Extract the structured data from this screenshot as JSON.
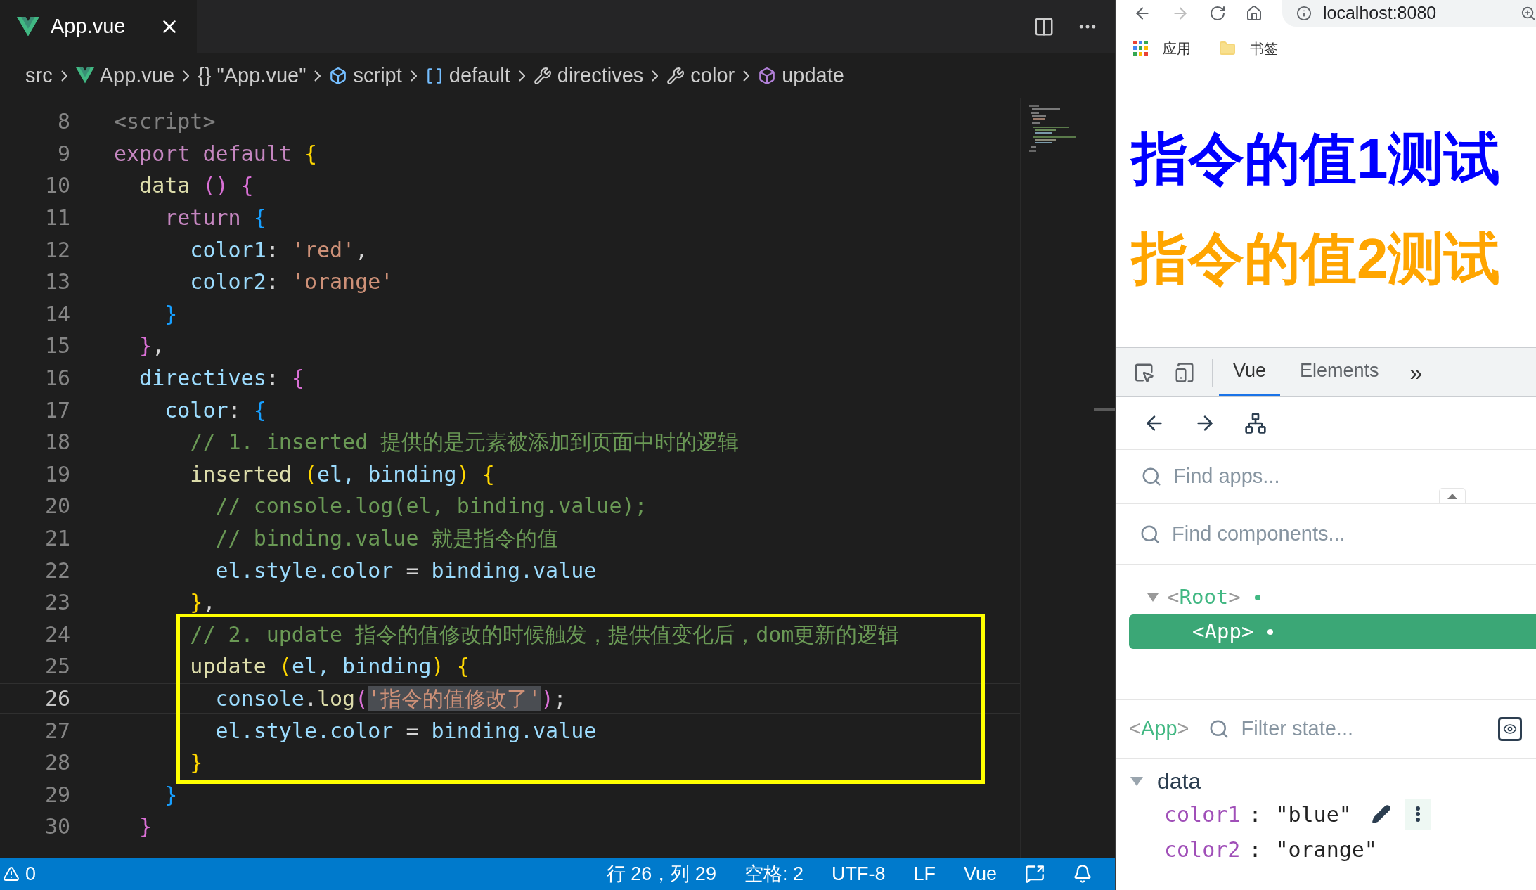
{
  "editor": {
    "tab": {
      "label": "App.vue",
      "selected": true
    },
    "breadcrumbs": [
      {
        "kind": "plain",
        "label": "src"
      },
      {
        "kind": "vue",
        "label": "App.vue"
      },
      {
        "kind": "braces",
        "glyph": "{}",
        "label": "\"App.vue\""
      },
      {
        "kind": "module",
        "label": "script"
      },
      {
        "kind": "variable",
        "label": "default"
      },
      {
        "kind": "wrench",
        "label": "directives"
      },
      {
        "kind": "wrench",
        "label": "color"
      },
      {
        "kind": "method",
        "label": "update"
      }
    ],
    "lines": [
      {
        "number": "8",
        "current": false,
        "boxed": false,
        "tokens": [
          {
            "text": "<script>",
            "kind": "tag"
          }
        ]
      },
      {
        "number": "9",
        "current": false,
        "boxed": false,
        "tokens": [
          {
            "text": "export default ",
            "kind": "keyword"
          },
          {
            "text": "{",
            "kind": "bracket1"
          }
        ]
      },
      {
        "number": "10",
        "current": false,
        "boxed": false,
        "tokens": [
          {
            "text": "  data ",
            "kind": "func"
          },
          {
            "text": "() {",
            "kind": "bracket2"
          }
        ]
      },
      {
        "number": "11",
        "current": false,
        "boxed": false,
        "tokens": [
          {
            "text": "    return ",
            "kind": "keyword"
          },
          {
            "text": "{",
            "kind": "bracket3"
          }
        ]
      },
      {
        "number": "12",
        "current": false,
        "boxed": false,
        "tokens": [
          {
            "text": "      color1",
            "kind": "prop"
          },
          {
            "text": ": ",
            "kind": "plain"
          },
          {
            "text": "'red'",
            "kind": "string"
          },
          {
            "text": ",",
            "kind": "plain"
          }
        ]
      },
      {
        "number": "13",
        "current": false,
        "boxed": false,
        "tokens": [
          {
            "text": "      color2",
            "kind": "prop"
          },
          {
            "text": ": ",
            "kind": "plain"
          },
          {
            "text": "'orange'",
            "kind": "string"
          }
        ]
      },
      {
        "number": "14",
        "current": false,
        "boxed": false,
        "tokens": [
          {
            "text": "    }",
            "kind": "bracket3"
          }
        ]
      },
      {
        "number": "15",
        "current": false,
        "boxed": false,
        "tokens": [
          {
            "text": "  }",
            "kind": "bracket2"
          },
          {
            "text": ",",
            "kind": "plain"
          }
        ]
      },
      {
        "number": "16",
        "current": false,
        "boxed": false,
        "tokens": [
          {
            "text": "  directives",
            "kind": "prop"
          },
          {
            "text": ": ",
            "kind": "plain"
          },
          {
            "text": "{",
            "kind": "bracket2"
          }
        ]
      },
      {
        "number": "17",
        "current": false,
        "boxed": false,
        "tokens": [
          {
            "text": "    color",
            "kind": "prop"
          },
          {
            "text": ": ",
            "kind": "plain"
          },
          {
            "text": "{",
            "kind": "bracket3"
          }
        ]
      },
      {
        "number": "18",
        "current": false,
        "boxed": false,
        "tokens": [
          {
            "text": "      // 1. inserted 提供的是元素被添加到页面中时的逻辑",
            "kind": "comment"
          }
        ]
      },
      {
        "number": "19",
        "current": false,
        "boxed": false,
        "tokens": [
          {
            "text": "      inserted ",
            "kind": "func"
          },
          {
            "text": "(",
            "kind": "bracket1"
          },
          {
            "text": "el, binding",
            "kind": "prop"
          },
          {
            "text": ") {",
            "kind": "bracket1"
          }
        ]
      },
      {
        "number": "20",
        "current": false,
        "boxed": false,
        "tokens": [
          {
            "text": "        // console.log(el, binding.value);",
            "kind": "comment"
          }
        ]
      },
      {
        "number": "21",
        "current": false,
        "boxed": false,
        "tokens": [
          {
            "text": "        // binding.value 就是指令的值",
            "kind": "comment"
          }
        ]
      },
      {
        "number": "22",
        "current": false,
        "boxed": false,
        "tokens": [
          {
            "text": "        el.style.color",
            "kind": "prop"
          },
          {
            "text": " = ",
            "kind": "plain"
          },
          {
            "text": "binding.value",
            "kind": "prop"
          }
        ]
      },
      {
        "number": "23",
        "current": false,
        "boxed": false,
        "tokens": [
          {
            "text": "      }",
            "kind": "bracket1"
          },
          {
            "text": ",",
            "kind": "plain"
          }
        ]
      },
      {
        "number": "24",
        "current": false,
        "boxed": true,
        "tokens": [
          {
            "text": "      // 2. update 指令的值修改的时候触发，提供值变化后，dom更新的逻辑",
            "kind": "comment"
          }
        ]
      },
      {
        "number": "25",
        "current": false,
        "boxed": true,
        "tokens": [
          {
            "text": "      update ",
            "kind": "func"
          },
          {
            "text": "(",
            "kind": "bracket1"
          },
          {
            "text": "el, binding",
            "kind": "prop"
          },
          {
            "text": ") {",
            "kind": "bracket1"
          }
        ]
      },
      {
        "number": "26",
        "current": true,
        "boxed": true,
        "tokens": [
          {
            "text": "        console",
            "kind": "prop"
          },
          {
            "text": ".",
            "kind": "plain"
          },
          {
            "text": "log",
            "kind": "func"
          },
          {
            "text": "(",
            "kind": "bracket2"
          },
          {
            "text": "'指令的值修改了'",
            "kind": "string_match"
          },
          {
            "text": ")",
            "kind": "bracket2"
          },
          {
            "text": ";",
            "kind": "plain"
          }
        ]
      },
      {
        "number": "27",
        "current": false,
        "boxed": true,
        "tokens": [
          {
            "text": "        el.style.color",
            "kind": "prop"
          },
          {
            "text": " = ",
            "kind": "plain"
          },
          {
            "text": "binding.value",
            "kind": "prop"
          }
        ]
      },
      {
        "number": "28",
        "current": false,
        "boxed": true,
        "tokens": [
          {
            "text": "      }",
            "kind": "bracket1"
          }
        ]
      },
      {
        "number": "29",
        "current": false,
        "boxed": false,
        "tokens": [
          {
            "text": "    }",
            "kind": "bracket3"
          }
        ]
      },
      {
        "number": "30",
        "current": false,
        "boxed": false,
        "tokens": [
          {
            "text": "  }",
            "kind": "bracket2"
          }
        ]
      }
    ]
  },
  "status_bar": {
    "warnings": "0",
    "items": [
      "行 26，列 29",
      "空格: 2",
      "UTF-8",
      "LF",
      "Vue"
    ]
  },
  "browser": {
    "address": "localhost:8080",
    "bookmarks": [
      {
        "kind": "apps",
        "label": "应用"
      },
      {
        "kind": "folder",
        "label": "书签"
      }
    ],
    "page_texts": [
      {
        "text": "指令的值1测试",
        "color": "#0000ff"
      },
      {
        "text": "指令的值2测试",
        "color": "#ffa500"
      }
    ]
  },
  "devtools": {
    "tabs": [
      {
        "label": "Vue",
        "selected": true
      },
      {
        "label": "Elements",
        "selected": false
      }
    ],
    "overflow": "»",
    "find_apps": {
      "placeholder": "Find apps..."
    },
    "find_components": {
      "placeholder": "Find components..."
    },
    "tree": [
      {
        "label": "<Root>",
        "expanded": true,
        "selected": false,
        "children": [
          {
            "label": "<App>",
            "selected": true
          }
        ]
      }
    ],
    "inspector": {
      "component": "<App>",
      "filter": {
        "placeholder": "Filter state..."
      },
      "section": {
        "label": "data",
        "expanded": true,
        "rows": [
          {
            "key": "color1",
            "separator": ":",
            "value": "\"blue\"",
            "hovered": true
          },
          {
            "key": "color2",
            "separator": ":",
            "value": "\"orange\"",
            "hovered": false
          }
        ]
      }
    }
  }
}
